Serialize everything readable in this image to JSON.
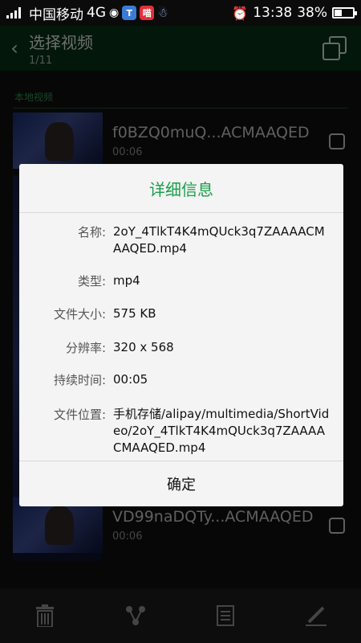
{
  "status_bar": {
    "carrier": "中国移动",
    "network": "4G",
    "time": "13:38",
    "battery": "38%",
    "battery_fraction": 0.38
  },
  "header": {
    "title": "选择视频",
    "count": "1/11"
  },
  "list": {
    "section_label": "本地视频",
    "items": [
      {
        "name": "f0BZQ0muQ...ACMAAQED",
        "duration": "00:06"
      },
      {
        "name": "VD99naDQTy...ACMAAQED",
        "duration": "00:06"
      }
    ]
  },
  "dialog": {
    "title": "详细信息",
    "fields": [
      {
        "label": "名称:",
        "value": "2oY_4TlkT4K4mQUck3q7ZAAAACMAAQED.mp4"
      },
      {
        "label": "类型:",
        "value": "mp4"
      },
      {
        "label": "文件大小:",
        "value": "575 KB"
      },
      {
        "label": "分辨率:",
        "value": "320 x 568"
      },
      {
        "label": "持续时间:",
        "value": "00:05"
      },
      {
        "label": "文件位置:",
        "value": "手机存储/alipay/multimedia/ShortVideo/2oY_4TlkT4K4mQUck3q7ZAAAACMAAQED.mp4"
      }
    ],
    "confirm_label": "确定"
  },
  "toolbar": {
    "icons": [
      "trash-icon",
      "share-icon",
      "document-icon",
      "edit-icon"
    ]
  },
  "colors": {
    "accent_green": "#17a049",
    "header_bg": "#062e16"
  }
}
